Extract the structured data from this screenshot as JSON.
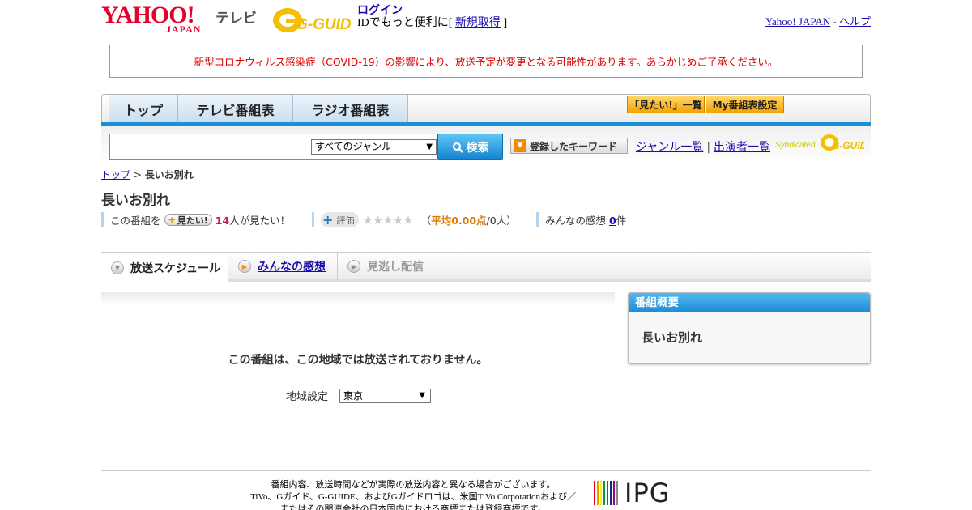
{
  "header": {
    "yahoo_logo": "YAHOO!",
    "yahoo_sub": "JAPAN",
    "tv_label": "テレビ",
    "gguide_logo": "G-GUIDE",
    "login_label": "ログイン",
    "id_text": "IDでもっと便利に[",
    "signup_label": "新規取得",
    "id_close": "]",
    "yahoo_japan_link": "Yahoo! JAPAN",
    "dash": "-",
    "help_link": "ヘルプ"
  },
  "notice": "新型コロナウィルス感染症（COVID-19）の影響により、放送予定が変更となる可能性があります。あらかじめご了承ください。",
  "nav": {
    "top": "トップ",
    "tv": "テレビ番組表",
    "radio": "ラジオ番組表",
    "mitai_list": "「見たい!」一覧",
    "my_settings": "My番組表設定"
  },
  "search": {
    "genre_selected": "すべてのジャンル",
    "search_button": "検索",
    "keyword_button": "登録したキーワード",
    "genre_list": "ジャンル一覧",
    "sep": "|",
    "performer_list": "出演者一覧",
    "syndicated": "Syndicated",
    "syndicated_logo": "G-GUIDE"
  },
  "breadcrumb": {
    "top": "トップ",
    "sep": ">",
    "current": "長いお別れ"
  },
  "title": "長いお別れ",
  "info": {
    "kono": "この番組を",
    "mitai_pill": "見たい!",
    "count": "14",
    "count_suffix": "人が見たい！",
    "rating_pill": "評価",
    "rating_open": "（",
    "rating_avg": "平均0.00点",
    "rating_people": "/0人）",
    "rating_stars": 0,
    "kanso_label": "みんなの感想",
    "kanso_count": "0",
    "kanso_suffix": "件"
  },
  "subtabs": {
    "schedule": "放送スケジュール",
    "kanso": "みんなの感想",
    "minogashi": "見逃し配信"
  },
  "main": {
    "not_broadcast": "この番組は、この地域では放送されておりません。",
    "region_label": "地域設定",
    "region_selected": "東京"
  },
  "summary": {
    "head": "番組概要",
    "title": "長いお別れ"
  },
  "footer": {
    "line1": "番組内容、放送時間などが実際の放送内容と異なる場合がございます。",
    "line2": "TiVo、Gガイド、G-GUIDE、およびGガイドロゴは、米国TiVo Corporationおよび／",
    "line3": "またはその関連会社の日本国内における商標または登録商標です。",
    "ipg": "IPG"
  },
  "colors": {
    "accent_blue": "#1b8fd6",
    "notice_red": "#dd0000",
    "yahoo_red": "#e4002b",
    "count_pink": "#c8175d",
    "rating_orange": "#e07800"
  }
}
